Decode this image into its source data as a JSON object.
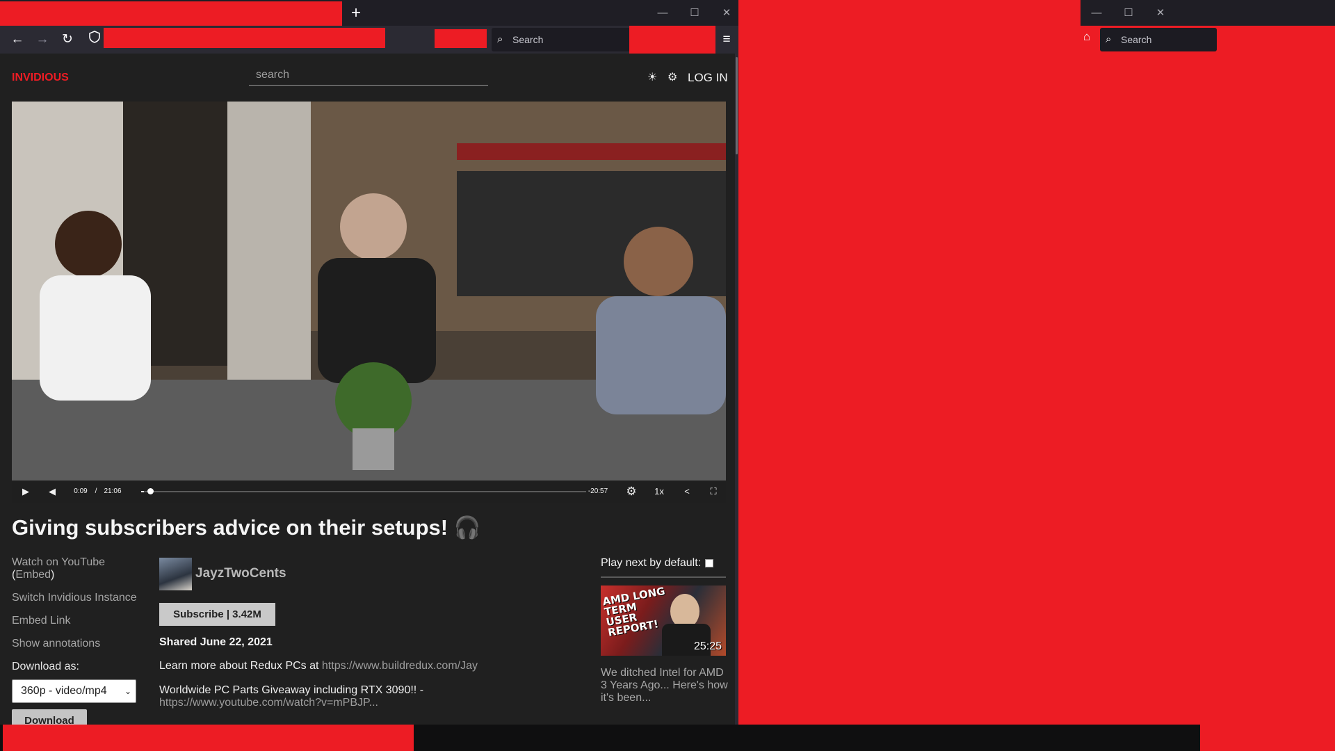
{
  "browser": {
    "new_tab_icon": "plus-icon",
    "window_controls": [
      "—",
      "☐",
      "✕"
    ],
    "nav_icons": [
      "back-arrow-icon",
      "forward-arrow-icon",
      "reload-icon",
      "shield-icon",
      "menu-icon"
    ],
    "search_placeholder": "Search"
  },
  "second_window": {
    "search_placeholder": "Search",
    "window_controls": [
      "—",
      "☐",
      "✕"
    ]
  },
  "site": {
    "logo": "INVIDIOUS",
    "search_placeholder": "search",
    "login": "LOG IN",
    "theme_icon": "sun-icon",
    "settings_icon": "gear-icon"
  },
  "player": {
    "current_time": "0:09",
    "separator": "/",
    "duration": "21:06",
    "remaining": "-20:57",
    "speed": "1x",
    "progress_fraction": 0.007
  },
  "video": {
    "title": "Giving subscribers advice on their setups! 🎧",
    "channel": "JayzTwoCents",
    "subscribe": "Subscribe | 3.42M",
    "shared": "Shared June 22, 2021",
    "description": [
      {
        "text": "Learn more about Redux PCs at ",
        "url": "https://www.buildredux.com/Jay"
      },
      {
        "text": "Worldwide PC Parts Giveaway including RTX 3090!! - ",
        "url": "https://www.youtube.com/watch?v=mPBJP..."
      }
    ]
  },
  "sidebar": {
    "watch_on_youtube": "Watch on YouTube",
    "embed_open": "(",
    "embed": "Embed",
    "embed_close": ")",
    "switch_instance": "Switch Invidious Instance",
    "embed_link": "Embed Link",
    "show_annotations": "Show annotations",
    "download_as": "Download as:",
    "download_option": "360p - video/mp4",
    "download_button": "Download"
  },
  "recommendations": {
    "play_next_label": "Play next by default:",
    "items": [
      {
        "thumb_text": "AMD LONG TERM USER REPORT!",
        "duration": "25:25",
        "title": "We ditched Intel for AMD 3 Years Ago... Here's how it's been..."
      }
    ]
  }
}
